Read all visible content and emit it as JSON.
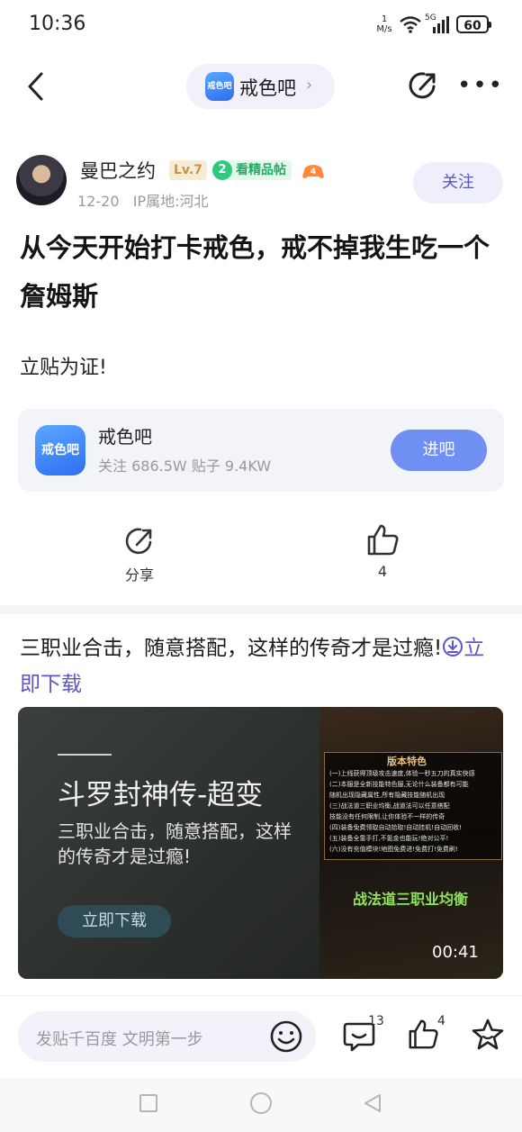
{
  "status_bar": {
    "time": "10:36",
    "net_speed_value": "1",
    "net_speed_unit": "M/s",
    "network": "5G",
    "battery": "60"
  },
  "nav": {
    "forum_name": "戒色吧",
    "forum_logo_text": "戒色吧"
  },
  "author": {
    "name": "曼巴之约",
    "level": "Lv.7",
    "badge_number": "2",
    "badge_label": "看精品帖",
    "game_badge_number": "4",
    "date": "12-20",
    "ip_location": "IP属地:河北",
    "follow_label": "关注"
  },
  "post": {
    "title": "从今天开始打卡戒色，戒不掉我生吃一个詹姆斯",
    "body": "立贴为证!"
  },
  "forum_card": {
    "name": "戒色吧",
    "stats": "关注 686.5W  贴子 9.4KW",
    "enter_label": "进吧",
    "logo_text": "戒色吧"
  },
  "actions": {
    "share_label": "分享",
    "like_count": "4"
  },
  "ad": {
    "text": "三职业合击，随意搭配，这样的传奇才是过瘾!",
    "link_label": "立即下载",
    "game_title": "斗罗封神传-超变",
    "slogan": "三职业合击，随意搭配，这样的传奇才是过瘾!",
    "button_label": "立即下载",
    "panel_title": "版本特色",
    "panel_lines": [
      "(一)上线获得顶级攻击速度,体验一秒五刀的真实快感",
      "(二)本服是全新技能特色服,无论什么装备都有可能",
      "随机出现隐藏属性,所有隐藏技能随机出现",
      "(三)战法道三职业均衡,战道法可以任意搭配",
      "技能没有任何限制,让你体验不一样的传奇",
      "(四)装备免费领取自动拾取!自动挂机!自动回收!",
      "(五)装备全靠手打,不氪金也能玩!绝对公平!",
      "(六)没有充值模块!地图免费进!免费打!免费刷!"
    ],
    "subtitle": "战法道三职业均衡",
    "duration": "00:41"
  },
  "bottom_bar": {
    "comment_placeholder": "发贴千百度 文明第一步",
    "comment_count": "13",
    "like_count": "4"
  },
  "icons": {
    "back": "chevron-left-icon",
    "share": "share-icon",
    "more": "more-icon",
    "like": "thumbs-up-icon",
    "emoji": "emoji-icon",
    "comment": "comment-icon",
    "star": "star-icon",
    "download": "download-icon"
  },
  "colors": {
    "accent": "#5d55c9",
    "enter_button": "#6f8ff2",
    "pill_bg": "#f1f0fb",
    "badge_green": "#2fc97c",
    "level_gold": "#c69446"
  }
}
